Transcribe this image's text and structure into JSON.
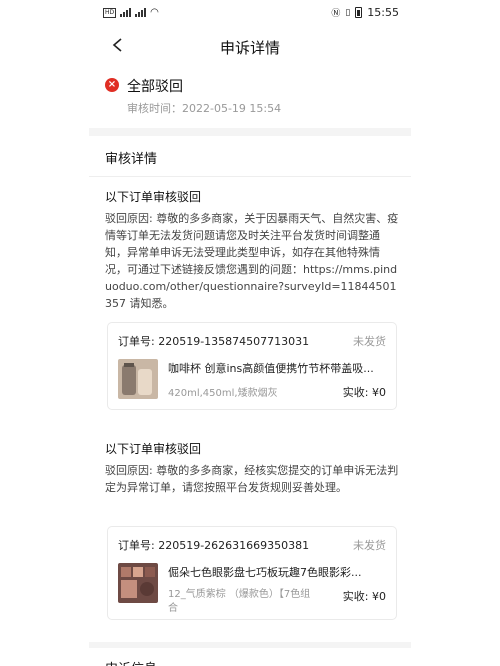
{
  "status_bar": {
    "left_label": "HD",
    "time": "15:55"
  },
  "nav": {
    "title": "申诉详情"
  },
  "result": {
    "title": "全部驳回",
    "review_time": "审核时间：2022-05-19 15:54"
  },
  "details": {
    "section_title": "审核详情",
    "groups": [
      {
        "title": "以下订单审核驳回",
        "reason": "驳回原因: 尊敬的多多商家，关于因暴雨天气、自然灾害、疫情等订单无法发货问题请您及时关注平台发货时间调整通知，异常单申诉无法受理此类型申诉，如存在其他特殊情况，可通过下述链接反馈您遇到的问题：https://mms.pinduoduo.com/other/questionnaire?surveyId=11844501357 请知悉。",
        "order": {
          "order_no": "订单号:  220519-135874507713031",
          "status": "未发货",
          "product_name": "咖啡杯 创意ins高颜值便携竹节杯带盖吸...",
          "spec": "420ml,450ml,矮款烟灰",
          "paid": "实收:  ¥0"
        }
      },
      {
        "title": "以下订单审核驳回",
        "reason": "驳回原因: 尊敬的多多商家，经核实您提交的订单申诉无法判定为异常订单，请您按照平台发货规则妥善处理。",
        "order": {
          "order_no": "订单号:  220519-262631669350381",
          "status": "未发货",
          "product_name": "倔朵七色眼影盘七巧板玩趣7色眼影彩...",
          "spec": "12_气质紫棕 （爆款色）【7色组合",
          "paid": "实收:  ¥0"
        }
      }
    ]
  },
  "bottom": {
    "title": "申诉信息"
  },
  "colors": {
    "accent_red": "#e02e24",
    "muted": "#999999",
    "page_bg": "#f4f4f4"
  }
}
